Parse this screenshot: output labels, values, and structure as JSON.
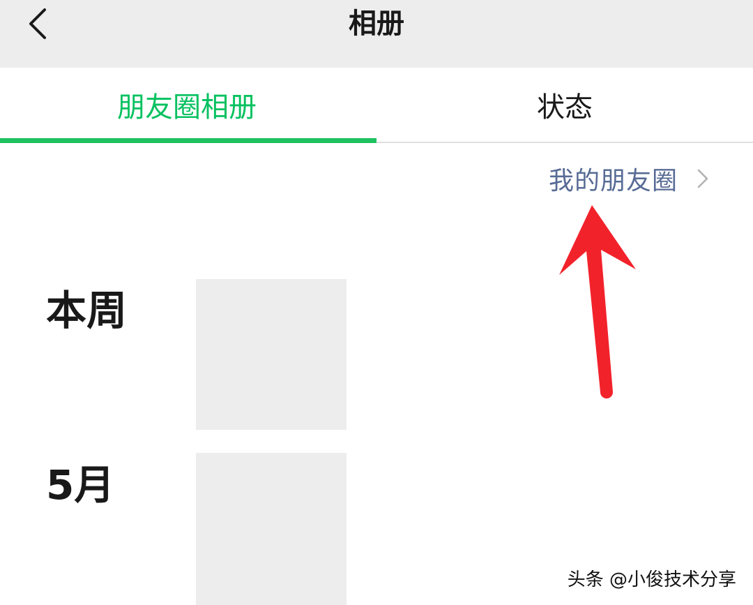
{
  "header": {
    "title": "相册",
    "back_icon": "chevron-left-icon"
  },
  "tabs": [
    {
      "label": "朋友圈相册",
      "active": true
    },
    {
      "label": "状态",
      "active": false
    }
  ],
  "moments_link": {
    "label": "我的朋友圈",
    "icon": "chevron-right-icon"
  },
  "sections": [
    {
      "label": "本周"
    },
    {
      "label": "5月"
    }
  ],
  "colors": {
    "accent_green": "#07c160",
    "link_blue": "#576b95",
    "annotation_red": "#f2222b",
    "nav_background": "#ededed"
  },
  "watermark": "头条 @小俊技术分享"
}
